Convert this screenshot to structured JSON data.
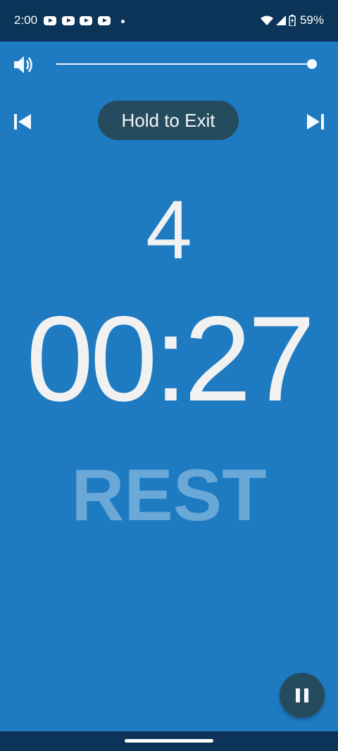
{
  "status_bar": {
    "time": "2:00",
    "battery": "59%",
    "icons": [
      "youtube-icon",
      "youtube-icon",
      "youtube-icon",
      "youtube-icon",
      "notification-dot",
      "wifi-icon",
      "signal-icon",
      "battery-charging-icon"
    ]
  },
  "controls": {
    "volume_level": 1.0,
    "hold_to_exit_label": "Hold to Exit",
    "prev_icon": "skip-previous-icon",
    "next_icon": "skip-next-icon",
    "pause_icon": "pause-icon"
  },
  "workout": {
    "round": "4",
    "timer": "00:27",
    "phase": "REST"
  },
  "colors": {
    "background": "#1e7bc2",
    "status_bar": "#0b3458",
    "button": "#244b5e",
    "phase_text": "#6aa8d8"
  }
}
